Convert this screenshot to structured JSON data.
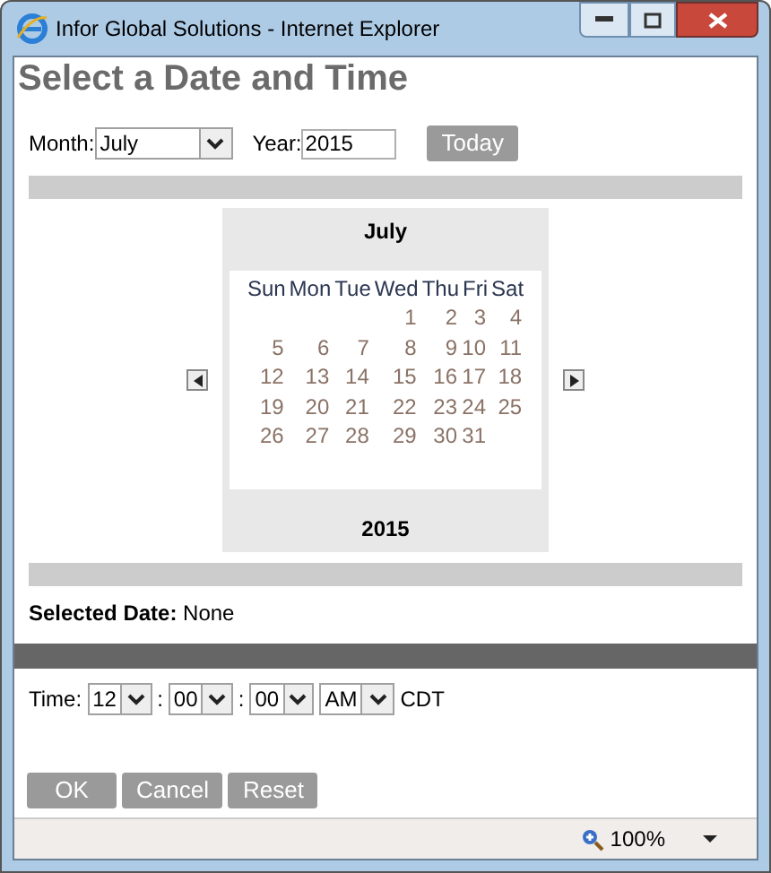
{
  "window": {
    "title": "Infor Global Solutions - Internet Explorer"
  },
  "heading": "Select a Date and Time",
  "month_field": {
    "label": "Month:",
    "value": "July"
  },
  "year_field": {
    "label": "Year:",
    "value": "2015"
  },
  "today_button": "Today",
  "calendar": {
    "month": "July",
    "year": "2015",
    "weekdays": [
      "Sun",
      "Mon",
      "Tue",
      "Wed",
      "Thu",
      "Fri",
      "Sat"
    ],
    "weeks": [
      {
        "kind": "first",
        "days": [
          "1",
          "2",
          "3",
          "4"
        ]
      },
      {
        "kind": "full",
        "days": [
          "5",
          "6",
          "7",
          "8",
          "9",
          "10",
          "11"
        ]
      },
      {
        "kind": "full",
        "days": [
          "12",
          "13",
          "14",
          "15",
          "16",
          "17",
          "18"
        ]
      },
      {
        "kind": "full",
        "days": [
          "19",
          "20",
          "21",
          "22",
          "23",
          "24",
          "25"
        ]
      },
      {
        "kind": "last",
        "days": [
          "26",
          "27",
          "28",
          "29",
          "30",
          "31"
        ]
      }
    ]
  },
  "selected_date": {
    "label": "Selected Date:",
    "value": "None"
  },
  "time": {
    "label": "Time:",
    "fields": [
      {
        "value": "12"
      },
      {
        "value": "00"
      },
      {
        "value": "00"
      },
      {
        "value": "AM"
      }
    ],
    "separator": ":",
    "zone": "CDT"
  },
  "buttons": [
    "OK",
    "Cancel",
    "Reset"
  ],
  "status_bar": {
    "zoom": "100%"
  }
}
